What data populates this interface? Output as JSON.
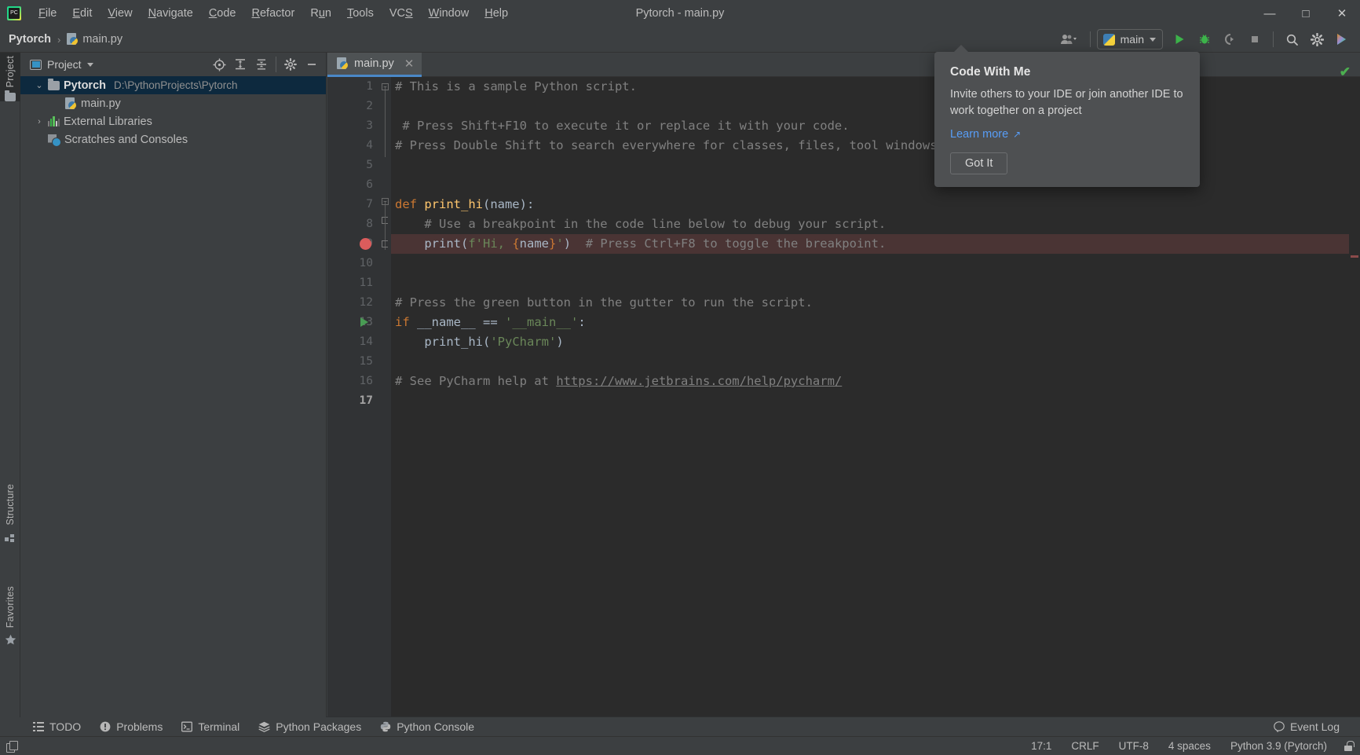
{
  "window": {
    "title": "Pytorch - main.py",
    "app_logo": "pycharm-logo",
    "controls": {
      "minimize": "—",
      "maximize": "□",
      "close": "✕"
    }
  },
  "menubar": {
    "items": [
      {
        "label": "File",
        "mnemonic": "F"
      },
      {
        "label": "Edit",
        "mnemonic": "E"
      },
      {
        "label": "View",
        "mnemonic": "V"
      },
      {
        "label": "Navigate",
        "mnemonic": "N"
      },
      {
        "label": "Code",
        "mnemonic": "C"
      },
      {
        "label": "Refactor",
        "mnemonic": "R"
      },
      {
        "label": "Run",
        "mnemonic": "u"
      },
      {
        "label": "Tools",
        "mnemonic": "T"
      },
      {
        "label": "VCS",
        "mnemonic": "S"
      },
      {
        "label": "Window",
        "mnemonic": "W"
      },
      {
        "label": "Help",
        "mnemonic": "H"
      }
    ]
  },
  "navbar": {
    "breadcrumb": [
      {
        "label": "Pytorch",
        "bold": true
      },
      {
        "label": "main.py",
        "bold": false,
        "icon": "python-file-icon"
      }
    ],
    "separator": "›",
    "run_config": {
      "label": "main",
      "icon": "python-logo"
    },
    "buttons": [
      {
        "name": "code-with-me-button",
        "icon": "people-icon"
      },
      {
        "name": "run-button",
        "icon": "run-play-icon"
      },
      {
        "name": "debug-button",
        "icon": "debug-bug-icon"
      },
      {
        "name": "run-with-coverage-button",
        "icon": "coverage-icon"
      },
      {
        "name": "stop-button",
        "icon": "stop-square-icon"
      },
      {
        "name": "search-everywhere-button",
        "icon": "search-icon"
      },
      {
        "name": "settings-button",
        "icon": "gear-icon"
      },
      {
        "name": "updates-button",
        "icon": "toolbox-icon"
      }
    ]
  },
  "left_stripe": {
    "items": [
      {
        "label": "Project",
        "active": true,
        "icon": "folder-icon"
      },
      {
        "label": "Structure",
        "active": false,
        "icon": "structure-icon"
      },
      {
        "label": "Favorites",
        "active": false,
        "icon": "star-icon"
      }
    ]
  },
  "project_panel": {
    "title": "Project",
    "toolbar": [
      {
        "name": "select-opened-file-button",
        "icon": "crosshair-target-icon"
      },
      {
        "name": "expand-all-button",
        "icon": "expand-all-icon"
      },
      {
        "name": "collapse-all-button",
        "icon": "collapse-all-icon"
      },
      {
        "name": "panel-options-button",
        "icon": "gear-icon"
      },
      {
        "name": "hide-panel-button",
        "icon": "minimize-icon"
      }
    ],
    "tree": [
      {
        "label": "Pytorch",
        "path": "D:\\PythonProjects\\Pytorch",
        "icon": "folder-icon",
        "arrow": "⌄",
        "selected": true,
        "depth": 0
      },
      {
        "label": "main.py",
        "path": "",
        "icon": "python-file-icon",
        "arrow": "",
        "selected": false,
        "depth": 1
      },
      {
        "label": "External Libraries",
        "path": "",
        "icon": "library-icon",
        "arrow": "›",
        "selected": false,
        "depth": 0
      },
      {
        "label": "Scratches and Consoles",
        "path": "",
        "icon": "scratches-icon",
        "arrow": "",
        "selected": false,
        "depth": 0
      }
    ]
  },
  "editor": {
    "tabs": [
      {
        "label": "main.py",
        "icon": "python-file-icon",
        "active": true,
        "close": "✕"
      }
    ],
    "current_line": 17,
    "lines": [
      {
        "num": 1,
        "tokens": [
          {
            "t": "# This is a sample Python script.",
            "c": "comment"
          }
        ]
      },
      {
        "num": 2,
        "tokens": []
      },
      {
        "num": 3,
        "tokens": [
          {
            "t": " # Press Shift+F10 to execute it or replace it with your code.",
            "c": "comment"
          }
        ]
      },
      {
        "num": 4,
        "tokens": [
          {
            "t": "# Press Double Shift to search everywhere for classes, files, tool windows, actions, and settings.",
            "c": "comment"
          }
        ]
      },
      {
        "num": 5,
        "tokens": []
      },
      {
        "num": 6,
        "tokens": []
      },
      {
        "num": 7,
        "tokens": [
          {
            "t": "def ",
            "c": "kw"
          },
          {
            "t": "print_hi",
            "c": "fn"
          },
          {
            "t": "(name):",
            "c": "plain"
          }
        ]
      },
      {
        "num": 8,
        "tokens": [
          {
            "t": "    # Use a breakpoint in the code line below to debug your script.",
            "c": "comment"
          }
        ]
      },
      {
        "num": 9,
        "tokens": [
          {
            "t": "    print(",
            "c": "plain"
          },
          {
            "t": "f'Hi, ",
            "c": "str"
          },
          {
            "t": "{",
            "c": "braces"
          },
          {
            "t": "name",
            "c": "plain"
          },
          {
            "t": "}",
            "c": "braces"
          },
          {
            "t": "'",
            "c": "str"
          },
          {
            "t": ")  ",
            "c": "plain"
          },
          {
            "t": "# Press Ctrl+F8 to toggle the breakpoint.",
            "c": "comment"
          }
        ]
      },
      {
        "num": 10,
        "tokens": []
      },
      {
        "num": 11,
        "tokens": []
      },
      {
        "num": 12,
        "tokens": [
          {
            "t": "# Press the green button in the gutter to run the script.",
            "c": "comment"
          }
        ]
      },
      {
        "num": 13,
        "tokens": [
          {
            "t": "if ",
            "c": "kw"
          },
          {
            "t": "__name__ ",
            "c": "plain"
          },
          {
            "t": "== ",
            "c": "plain"
          },
          {
            "t": "'__main__'",
            "c": "str"
          },
          {
            "t": ":",
            "c": "plain"
          }
        ]
      },
      {
        "num": 14,
        "tokens": [
          {
            "t": "    print_hi(",
            "c": "plain"
          },
          {
            "t": "'PyCharm'",
            "c": "str"
          },
          {
            "t": ")",
            "c": "plain"
          }
        ]
      },
      {
        "num": 15,
        "tokens": []
      },
      {
        "num": 16,
        "tokens": [
          {
            "t": "# See PyCharm help at ",
            "c": "comment"
          },
          {
            "t": "https://www.jetbrains.com/help/pycharm/",
            "c": "link"
          }
        ]
      },
      {
        "num": 17,
        "tokens": []
      }
    ],
    "breakpoint_line": 9,
    "run_marker_line": 13,
    "inspection_status": "ok-checkmark"
  },
  "code_with_me_popup": {
    "title": "Code With Me",
    "body": "Invite others to your IDE or join another IDE to work together on a project",
    "link": "Learn more",
    "link_arrow": "↗",
    "button": "Got It"
  },
  "bottom_tools": [
    {
      "label": "TODO",
      "icon": "todo-list-icon"
    },
    {
      "label": "Problems",
      "icon": "problems-warning-icon"
    },
    {
      "label": "Terminal",
      "icon": "terminal-icon"
    },
    {
      "label": "Python Packages",
      "icon": "packages-layers-icon"
    },
    {
      "label": "Python Console",
      "icon": "python-console-icon"
    }
  ],
  "event_log": {
    "label": "Event Log",
    "icon": "balloon-icon"
  },
  "statusbar": {
    "left_icon": "stack-windows-icon",
    "items": [
      {
        "label": "17:1",
        "name": "caret-position"
      },
      {
        "label": "CRLF",
        "name": "line-separator"
      },
      {
        "label": "UTF-8",
        "name": "file-encoding"
      },
      {
        "label": "4 spaces",
        "name": "indent-setting"
      },
      {
        "label": "Python 3.9 (Pytorch)",
        "name": "python-interpreter"
      }
    ],
    "lock_icon": "unlocked-icon"
  },
  "colors": {
    "chrome": "#3c3f41",
    "editor_bg": "#2b2b2b",
    "gutter_bg": "#313335",
    "selection": "#0d293e",
    "tab_accent": "#4a88c7",
    "breakpoint": "#db5c5c",
    "run_green": "#499c54",
    "link": "#589df6",
    "highlight_line": "#4a3434"
  }
}
